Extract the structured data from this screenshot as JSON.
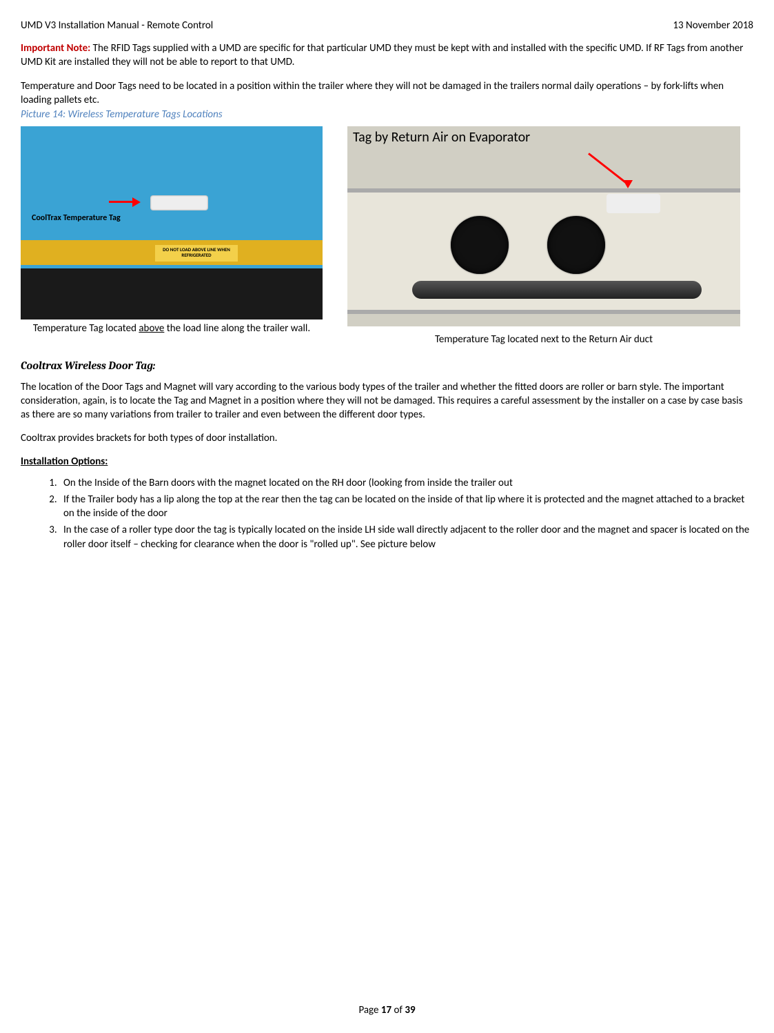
{
  "header": {
    "left": "UMD V3 Installation Manual - Remote Control",
    "right": "13 November 2018"
  },
  "important_label": "Important Note:",
  "important_text": " The RFID Tags supplied with a UMD are specific for that particular UMD they must be kept with and installed with the specific UMD. If RF Tags from another UMD Kit are installed they will not be able to report to that UMD.",
  "para_temp_note": "Temperature and Door Tags need to be located in a position within the trailer where they will not be damaged in the trailers normal daily operations – by fork-lifts when loading pallets etc.",
  "picture14_caption": "Picture 14: Wireless Temperature Tags Locations",
  "fig_left": {
    "overlay_label": "CoolTrax Temperature Tag",
    "warn_sign": "DO NOT LOAD ABOVE LINE WHEN REFRIGERATED",
    "caption_pre": "Temperature Tag located ",
    "caption_under": "above",
    "caption_post": " the load line along the trailer wall."
  },
  "fig_right": {
    "overlay_label": "Tag by Return Air on Evaporator",
    "caption": "Temperature Tag located next to the Return Air duct"
  },
  "door_tag_heading": "Cooltrax Wireless Door Tag:",
  "door_tag_para": "The location of the Door Tags and Magnet will vary according to the various body types of the trailer and whether the fitted doors are roller or barn style. The important consideration, again, is to locate the Tag and Magnet in a position where they will not be damaged. This requires a careful assessment by the installer on a case by case basis as there are so many variations from trailer to trailer and even between the different door types.",
  "brackets_para": "Cooltrax provides brackets for both types of door installation.",
  "install_heading": "Installation Options:",
  "install_options": [
    "On the Inside of the Barn doors with the magnet located on the RH door (looking from inside the trailer out",
    "If the Trailer body has a lip along the top at the rear then the tag can be located on the inside of that lip where it is protected and the magnet attached to a bracket on the inside of the door",
    "In the case of a roller type door the tag is typically located on the inside LH side wall directly adjacent to the roller door and the magnet and spacer is located on the roller door itself – checking for clearance when the door is \"rolled up\". See picture below"
  ],
  "footer": {
    "pre": "Page ",
    "page": "17",
    "mid": " of ",
    "total": "39"
  }
}
